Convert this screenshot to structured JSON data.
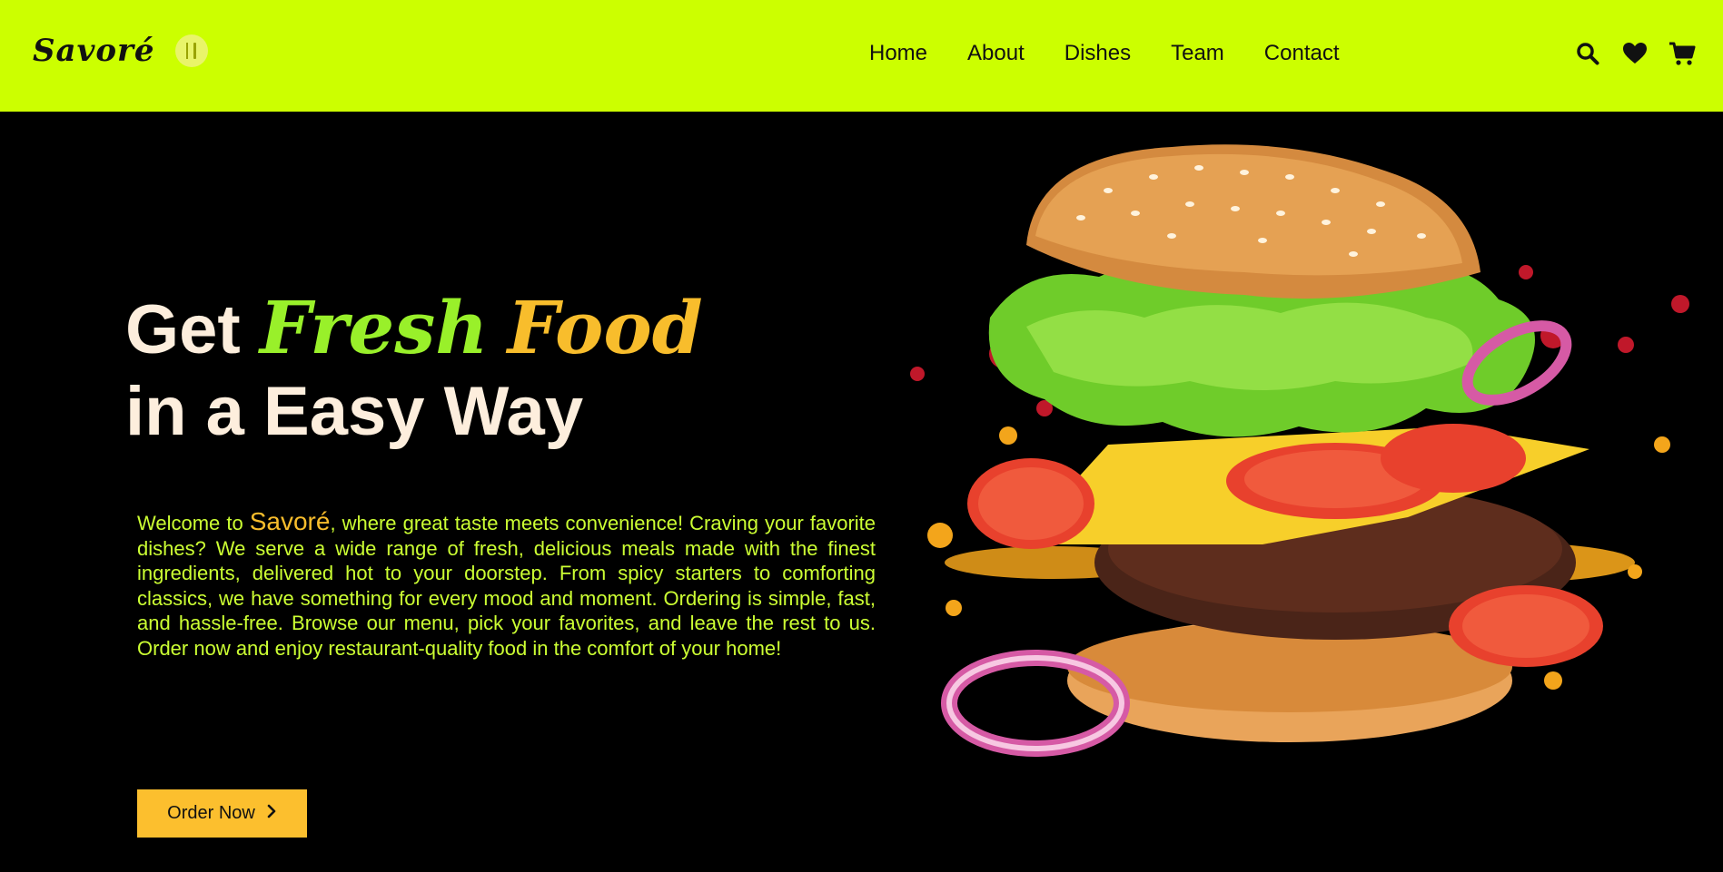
{
  "header": {
    "brand": "Savoré",
    "nav": [
      "Home",
      "About",
      "Dishes",
      "Team",
      "Contact"
    ],
    "icons": [
      "search-icon",
      "heart-icon",
      "cart-icon"
    ]
  },
  "hero": {
    "title_word1": "Get",
    "title_word2": "Fresh",
    "title_word3": "Food",
    "title_line2": "in a Easy Way",
    "desc_prefix": "Welcome to ",
    "desc_brand": "Savoré",
    "desc_rest": ", where great taste meets convenience! Craving your favorite dishes? We serve a wide range of fresh, delicious meals made with the finest ingredients, delivered hot to your doorstep. From spicy starters to comforting classics, we have something for every mood and moment. Ordering is simple, fast, and hassle-free. Browse our menu, pick your favorites, and leave the rest to us. Order now and enjoy restaurant-quality food in the comfort of your home!",
    "cta_label": "Order Now"
  },
  "colors": {
    "nav_bg": "#ccff00",
    "accent_green": "#99f02a",
    "accent_yellow": "#f8bd2c",
    "text_lime": "#ccff33",
    "title_cream": "#fdeedd"
  }
}
